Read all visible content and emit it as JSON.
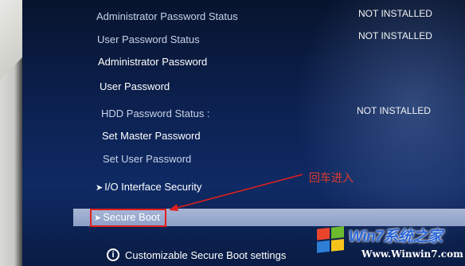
{
  "menu": {
    "admin_status_label": "Administrator Password Status",
    "admin_status_value": "NOT INSTALLED",
    "user_status_label": "User Password Status",
    "user_status_value": "NOT INSTALLED",
    "admin_password": "Administrator Password",
    "user_password": "User Password",
    "hdd_status_label": "HDD Password Status  :",
    "hdd_status_value": "NOT INSTALLED",
    "set_master_password": "Set Master Password",
    "set_user_password": "Set User Password",
    "io_interface_security": "I/O Interface Security",
    "secure_boot": "Secure Boot"
  },
  "help_text": "Customizable Secure Boot settings",
  "annotation": "回车进入",
  "watermark": {
    "title": "Win7系统之家",
    "url": "Www.Winwin7.com"
  },
  "colors": {
    "background": "#0c2150",
    "highlight": "#8d9fc8",
    "annotation_red": "#e0201c"
  }
}
